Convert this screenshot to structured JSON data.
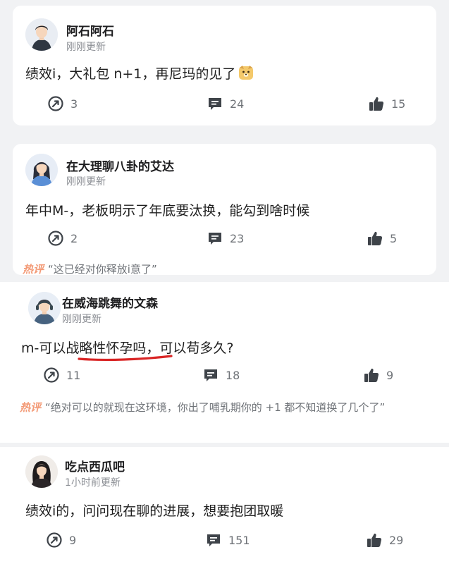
{
  "posts": [
    {
      "name": "阿石阿石",
      "time": "刚刚更新",
      "content": "绩效i，大礼包 n+1，再尼玛的见了",
      "shares": "3",
      "comments": "24",
      "likes": "15"
    },
    {
      "name": "在大理聊八卦的艾达",
      "time": "刚刚更新",
      "content": "年中M-，老板明示了年底要汰换，能勾到啥时候",
      "shares": "2",
      "comments": "23",
      "likes": "5",
      "hot_label": "热评",
      "hot_comment": "“这已经对你释放i意了”"
    },
    {
      "name": "在威海跳舞的文森",
      "time": "刚刚更新",
      "content": "m-可以战略性怀孕吗，可以苟多久?",
      "shares": "11",
      "comments": "18",
      "likes": "9",
      "hot_label": "热评",
      "hot_comment": "“绝对可以的就现在这环境，你出了哺乳期你的 +1 都不知道换了几个了”"
    },
    {
      "name": "吃点西瓜吧",
      "time": "1小时前更新",
      "content": "绩效i的，问问现在聊的进展，想要抱团取暖",
      "shares": "9",
      "comments": "151",
      "likes": "29"
    }
  ],
  "icons": {
    "share": "share-icon",
    "comment": "comment-icon",
    "like": "thumbs-up-icon",
    "emoji": "dog-face-emoji"
  },
  "colors": {
    "background": "#f1f2f4",
    "card": "#ffffff",
    "icon": "#3e4349",
    "hot_label": "#f39a76",
    "underline": "#d92525"
  }
}
